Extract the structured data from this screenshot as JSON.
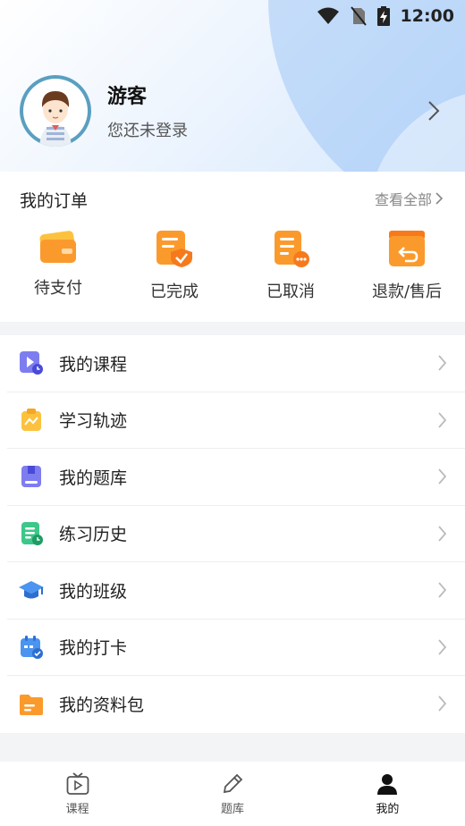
{
  "status_bar": {
    "time": "12:00"
  },
  "profile": {
    "name": "游客",
    "subtitle": "您还未登录"
  },
  "orders": {
    "title": "我的订单",
    "view_all": "查看全部",
    "items": [
      {
        "label": "待支付",
        "icon": "wallet-icon"
      },
      {
        "label": "已完成",
        "icon": "completed-order-icon"
      },
      {
        "label": "已取消",
        "icon": "cancelled-order-icon"
      },
      {
        "label": "退款/售后",
        "icon": "refund-icon"
      }
    ]
  },
  "menu": {
    "items": [
      {
        "label": "我的课程",
        "icon": "course-play-icon"
      },
      {
        "label": "学习轨迹",
        "icon": "learning-track-icon"
      },
      {
        "label": "我的题库",
        "icon": "question-bank-icon"
      },
      {
        "label": "练习历史",
        "icon": "practice-history-icon"
      },
      {
        "label": "我的班级",
        "icon": "graduation-cap-icon"
      },
      {
        "label": "我的打卡",
        "icon": "check-in-calendar-icon"
      },
      {
        "label": "我的资料包",
        "icon": "folder-icon"
      }
    ]
  },
  "tabbar": {
    "tabs": [
      {
        "label": "课程",
        "icon": "tv-play-icon",
        "active": false
      },
      {
        "label": "题库",
        "icon": "pencil-icon",
        "active": false
      },
      {
        "label": "我的",
        "icon": "person-icon",
        "active": true
      }
    ]
  },
  "colors": {
    "orange": "#fb9a2c",
    "purple": "#7d7df0",
    "yellow": "#fcc23f",
    "green": "#3dc78a",
    "blue": "#4b94f0"
  }
}
